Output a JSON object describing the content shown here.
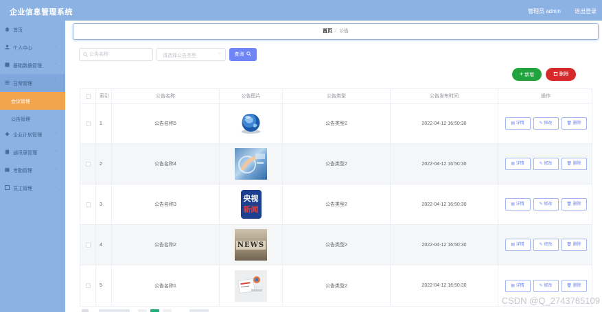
{
  "app": {
    "title": "企业信息管理系统",
    "user": "管理员 admin",
    "logout": "退出登录"
  },
  "sidebar": {
    "items": [
      {
        "label": "首页",
        "icon": "home-icon"
      },
      {
        "label": "个人中心",
        "icon": "user-icon"
      },
      {
        "label": "基础数据管理",
        "icon": "grid-icon"
      },
      {
        "label": "日常管理",
        "icon": "list-icon"
      },
      {
        "label": "会议管理",
        "sub": true,
        "selected": true
      },
      {
        "label": "公告管理",
        "sub": true
      },
      {
        "label": "企业计划管理",
        "icon": "plan-icon"
      },
      {
        "label": "通讯录管理",
        "icon": "contacts-icon"
      },
      {
        "label": "考勤管理",
        "icon": "calendar-icon"
      },
      {
        "label": "员工管理",
        "icon": "staff-icon"
      }
    ]
  },
  "breadcrumb": {
    "home": "首页",
    "separator": "/",
    "current": "公告"
  },
  "search": {
    "name_placeholder": "公告名称",
    "type_placeholder": "请选择公告类型",
    "query_label": "查询"
  },
  "actions": {
    "add_label": "新增",
    "delete_label": "删除"
  },
  "table": {
    "headers": [
      "索引",
      "公告名称",
      "公告图片",
      "公告类型",
      "公告发布时间",
      "操作"
    ],
    "rows": [
      {
        "index": "1",
        "name": "公告名称5",
        "image": "globe",
        "type": "公告类型2",
        "time": "2022-04-12 16:50:30"
      },
      {
        "index": "2",
        "name": "公告名称4",
        "image": "tech",
        "type": "公告类型2",
        "time": "2022-04-12 16:50:30"
      },
      {
        "index": "3",
        "name": "公告名称3",
        "image": "cctv",
        "type": "公告类型2",
        "time": "2022-04-12 16:50:30"
      },
      {
        "index": "4",
        "name": "公告名称2",
        "image": "news",
        "type": "公告类型2",
        "time": "2022-04-12 16:50:30"
      },
      {
        "index": "5",
        "name": "公告名称1",
        "image": "papers",
        "type": "公告类型2",
        "time": "2022-04-12 16:50:30"
      }
    ],
    "op_labels": {
      "detail": "详情",
      "edit": "修改",
      "remove": "删除"
    },
    "image_text": {
      "cctv_top": "央视",
      "cctv_bottom": "新闻",
      "news": "NEWS"
    }
  },
  "watermark": "CSDN @Q_2743785109",
  "colors": {
    "sidebar": "#8cb2e4",
    "selected": "#f0a44c",
    "primary": "#6d85f5",
    "success": "#21a33e",
    "danger": "#d62a2a"
  }
}
